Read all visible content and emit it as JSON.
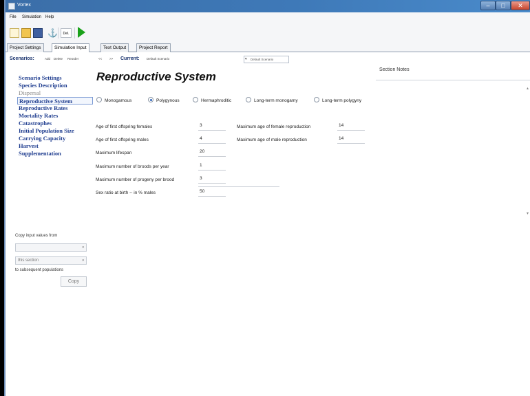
{
  "window": {
    "title": "Vortex"
  },
  "menu": [
    "File",
    "Simulation",
    "Help"
  ],
  "toolbar": {
    "delete_label": "Del."
  },
  "tabs": [
    "Project Settings",
    "Simulation Input",
    "Text Output",
    "Project Report"
  ],
  "scenarios": {
    "label": "Scenarios:",
    "actions": [
      "Add",
      "Delete",
      "Reorder"
    ],
    "nav": [
      "<<",
      ">>"
    ],
    "current_label": "Current:",
    "current_name": "Default Scenario",
    "dropdown_value": "Default Scenario"
  },
  "sections": [
    "Scenario Settings",
    "Species Description",
    "Dispersal",
    "Reproductive System",
    "Reproductive Rates",
    "Mortality Rates",
    "Catastrophes",
    "Initial Population Size",
    "Carrying Capacity",
    "Harvest",
    "Supplementation"
  ],
  "copy": {
    "title": "Copy input values from",
    "from_value": "",
    "section_value": "this section",
    "to_label": "to subsequent populations",
    "button": "Copy"
  },
  "main": {
    "heading": "Reproductive System",
    "mating_options": [
      "Monogamous",
      "Polygynous",
      "Hermaphroditic",
      "Long-term monogamy",
      "Long-term polygyny"
    ],
    "selected_option": "Polygynous",
    "fields_left": [
      {
        "label": "Age of first offspring females",
        "value": "3"
      },
      {
        "label": "Age of first offspring males",
        "value": "4"
      },
      {
        "label": "Maximum lifespan",
        "value": "20"
      },
      {
        "label": "Maximum number of broods per year",
        "value": "1"
      },
      {
        "label": "Maximum number of progeny per brood",
        "value": "3"
      },
      {
        "label": "Sex ratio at birth -- in % males",
        "value": "50"
      }
    ],
    "fields_right": [
      {
        "label": "Maximum age of female reproduction",
        "value": "14"
      },
      {
        "label": "Maximum age of male reproduction",
        "value": "14"
      }
    ]
  },
  "notes": {
    "label": "Section Notes"
  }
}
